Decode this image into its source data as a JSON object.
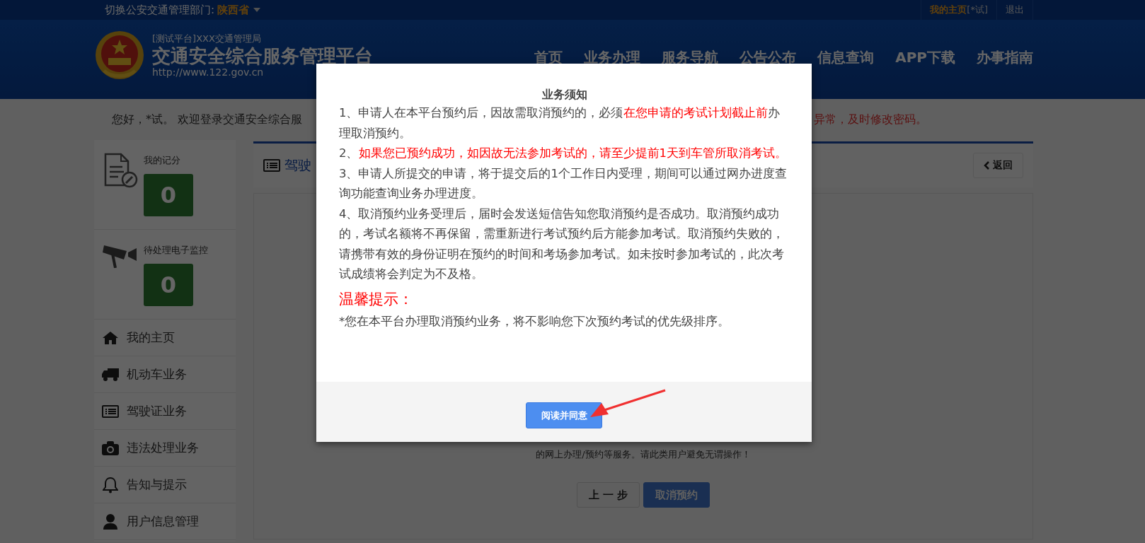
{
  "top_bar": {
    "switch_label": "切换公安交通管理部门:",
    "region": "陕西省",
    "home_link": "我的主页",
    "user_tag": "[*试]",
    "logout": "退出"
  },
  "header": {
    "subtitle": "[测试平台]XXX交通管理局",
    "title": "交通安全综合服务管理平台",
    "url": "http://www.122.gov.cn",
    "nav": [
      "首页",
      "业务办理",
      "服务导航",
      "公告公布",
      "信息查询",
      "APP下载",
      "办事指南"
    ]
  },
  "welcome": {
    "left": "您好，*试。 欢迎登录交通安全综合服",
    "right": "异常，及时修改密码。"
  },
  "sidebar": {
    "cards": [
      {
        "kind": "document",
        "label": "我的记分",
        "value": "0"
      },
      {
        "kind": "camera",
        "label": "待处理电子监控",
        "value": "0"
      }
    ],
    "items": [
      {
        "kind": "home",
        "label": "我的主页"
      },
      {
        "kind": "truck",
        "label": "机动车业务"
      },
      {
        "kind": "card",
        "label": "驾驶证业务"
      },
      {
        "kind": "photo",
        "label": "违法处理业务"
      },
      {
        "kind": "bell",
        "label": "告知与提示"
      },
      {
        "kind": "user",
        "label": "用户信息管理"
      }
    ]
  },
  "panel": {
    "title": "驾驶",
    "back_button": "返回",
    "notice_tail": "的网上办理/预约等服务。请此类用户避免无谓操作！",
    "buttons": [
      {
        "label": "上 一 步",
        "primary": false
      },
      {
        "label": "取消预约",
        "primary": true
      }
    ]
  },
  "modal": {
    "title": "业务须知",
    "paragraphs": [
      [
        {
          "text": "1、申请人在本平台预约后，因故需取消预约的，必须",
          "highlight": false
        },
        {
          "text": "在您申请的考试计划截止前",
          "highlight": true
        },
        {
          "text": "办理取消预约。",
          "highlight": false
        }
      ],
      [
        {
          "text": "2、",
          "highlight": false
        },
        {
          "text": "如果您已预约成功，如因故无法参加考试的，请至少提前1天到车管所取消考试。",
          "highlight": true
        }
      ],
      [
        {
          "text": "3、申请人所提交的申请，将于提交后的1个工作日内受理，期间可以通过网办进度查询功能查询业务办理进度。",
          "highlight": false
        }
      ],
      [
        {
          "text": "4、取消预约业务受理后，届时会发送短信告知您取消预约是否成功。取消预约成功的，考试名额将不再保留，需重新进行考试预约后方能参加考试。取消预约失败的，请携带有效的身份证明在预约的时间和考场参加考试。如未按时参加考试的，此次考试成绩将会判定为不及格。",
          "highlight": false
        }
      ]
    ],
    "tip_heading": "温馨提示：",
    "tip": "*您在本平台办理取消预约业务，将不影响您下次预约考试的优先级排序。",
    "confirm_button": "阅读并同意"
  }
}
